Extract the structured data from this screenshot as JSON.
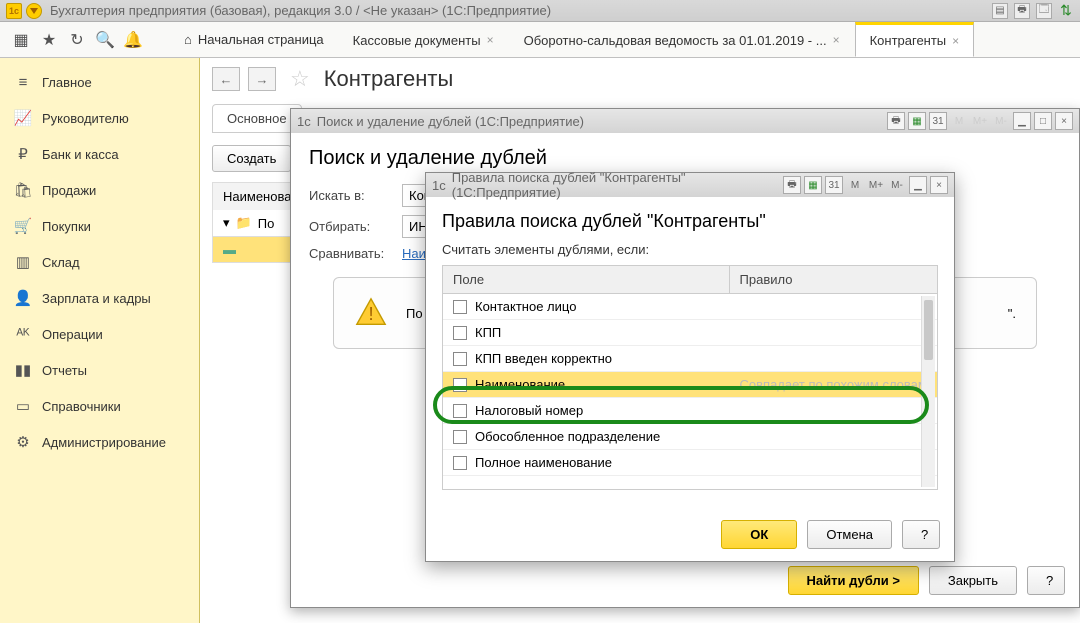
{
  "titlebar": {
    "text": "Бухгалтерия предприятия (базовая), редакция 3.0 / <Не указан>  (1С:Предприятие)"
  },
  "tabs": {
    "home": "Начальная страница",
    "t1": "Кассовые документы",
    "t2": "Оборотно-сальдовая ведомость за 01.01.2019 - ...",
    "t3": "Контрагенты"
  },
  "sidebar": {
    "items": [
      "Главное",
      "Руководителю",
      "Банк и касса",
      "Продажи",
      "Покупки",
      "Склад",
      "Зарплата и кадры",
      "Операции",
      "Отчеты",
      "Справочники",
      "Администрирование"
    ]
  },
  "content": {
    "title": "Контрагенты",
    "subtab": "Основное",
    "create": "Создать",
    "list_header": "Наименова",
    "row1": "По",
    "row2": ""
  },
  "dlg1": {
    "caption": "Поиск и удаление дублей  (1С:Предприятие)",
    "title": "Поиск и удаление дублей",
    "search_in_lbl": "Искать в:",
    "search_in_val": "Конт",
    "filter_lbl": "Отбирать:",
    "filter_val": "ИНН",
    "compare_lbl": "Сравнивать:",
    "compare_link": "Наи",
    "warn": "По",
    "warn_tail": "\".",
    "m_lbls": [
      "M",
      "M+",
      "M-"
    ],
    "find": "Найти дубли >",
    "close": "Закрыть",
    "q": "?"
  },
  "dlg2": {
    "caption": "Правила поиска дублей \"Контрагенты\"  (1С:Предприятие)",
    "title": "Правила поиска дублей \"Контрагенты\"",
    "consider": "Считать элементы дублями, если:",
    "col_field": "Поле",
    "col_rule": "Правило",
    "rows": [
      {
        "label": "Контактное лицо",
        "rule": ""
      },
      {
        "label": "КПП",
        "rule": ""
      },
      {
        "label": "КПП введен корректно",
        "rule": ""
      },
      {
        "label": "Наименование",
        "rule": "Совпадает по похожим словам",
        "sel": true
      },
      {
        "label": "Налоговый номер",
        "rule": ""
      },
      {
        "label": "Обособленное подразделение",
        "rule": ""
      },
      {
        "label": "Полное наименование",
        "rule": ""
      }
    ],
    "m_lbls": [
      "M",
      "M+",
      "M-"
    ],
    "ok": "ОК",
    "cancel": "Отмена",
    "q": "?"
  }
}
